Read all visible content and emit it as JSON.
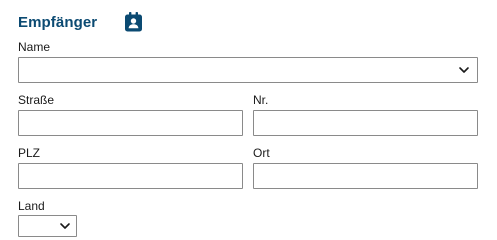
{
  "section": {
    "title": "Empfänger",
    "addressbook_icon": "contact-book-icon"
  },
  "accent_color": "#0b4a72",
  "fields": {
    "name": {
      "label": "Name",
      "value": ""
    },
    "street": {
      "label": "Straße",
      "value": ""
    },
    "number": {
      "label": "Nr.",
      "value": ""
    },
    "zip": {
      "label": "PLZ",
      "value": ""
    },
    "city": {
      "label": "Ort",
      "value": ""
    },
    "country": {
      "label": "Land",
      "value": ""
    }
  }
}
